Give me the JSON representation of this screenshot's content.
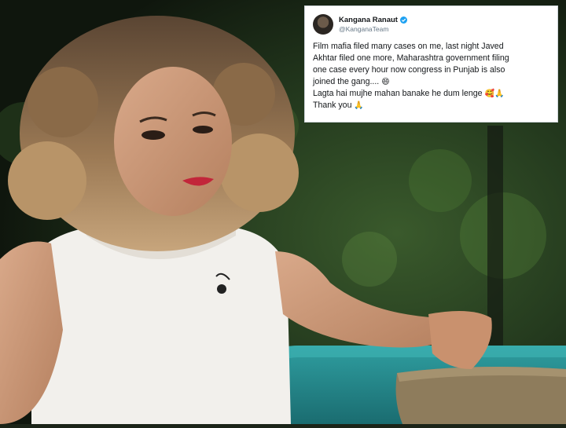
{
  "photo": {
    "description_icon": "woman-on-green-sofa-photo"
  },
  "tweet": {
    "display_name": "Kangana Ranaut",
    "handle": "@KanganaTeam",
    "verified": true,
    "lines": [
      "Film mafia filed many cases on me, last night Javed",
      "Akhtar filed one more, Maharashtra government filing",
      "one case every hour now congress in Punjab is also",
      "joined the gang....",
      "Lagta hai mujhe mahan banake he dum lenge",
      "Thank you"
    ],
    "emoji_grin": "😄",
    "emoji_love": "🥰",
    "emoji_pray": "🙏",
    "accent_color": "#1da1f2"
  }
}
